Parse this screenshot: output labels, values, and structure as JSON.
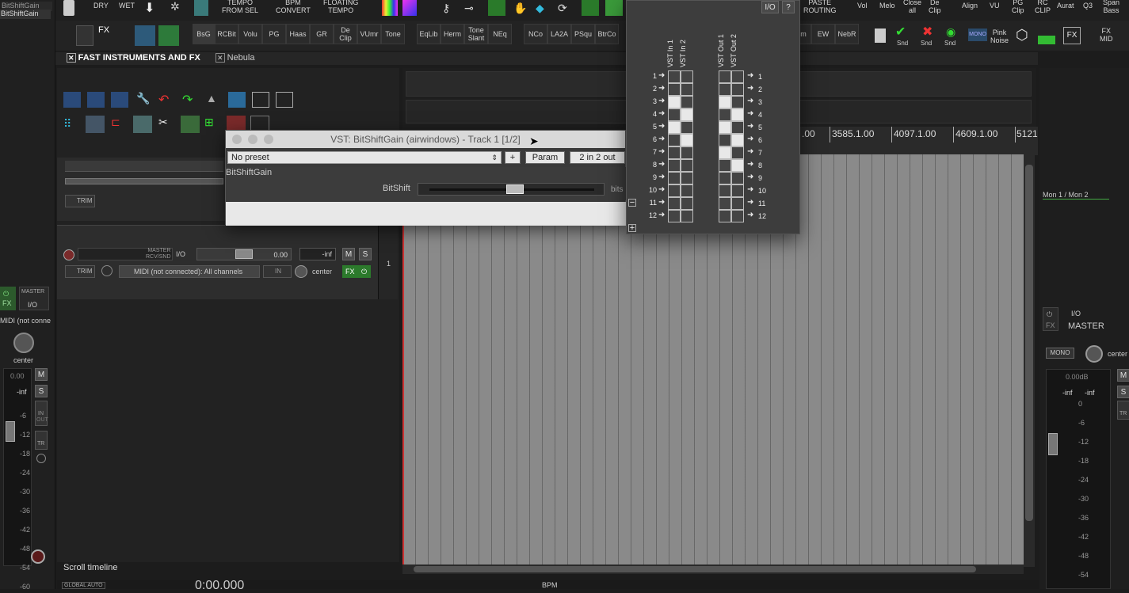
{
  "left_mixer": {
    "track_names": [
      "BitShiftGain",
      "BitShiftGain"
    ],
    "fx_label": "FX",
    "master_label": "MASTER",
    "io_label": "I/O",
    "midi_text": "MIDI (not conne",
    "pan_label": "center",
    "vol_value": "0.00",
    "peak_value": "-inf",
    "mute": "M",
    "solo": "S",
    "in_label": "IN",
    "out_label": "OUT",
    "trim_label": "TR",
    "scale": [
      "-6",
      "-12",
      "-18",
      "-24",
      "-30",
      "-36",
      "-42",
      "-48",
      "-54",
      "-60"
    ]
  },
  "toolbar_top": {
    "buttons": [
      "DRY",
      "WET",
      "TEMPO\nFROM SEL",
      "BPM\nCONVERT",
      "FLOATING\nTEMPO",
      "PASTE\nROUTING",
      "Vol",
      "Melo",
      "Close\nall",
      "De\nClip",
      "Align",
      "VU",
      "PG\nClip",
      "RC\nCLIP",
      "Aurat",
      "Q3",
      "Span\nBass"
    ]
  },
  "toolbar_2": {
    "fx_label": "FX",
    "buttons": [
      "BsG",
      "RCBit",
      "Volu",
      "PG",
      "Haas",
      "GR",
      "De\nClip",
      "VUmr",
      "Tone",
      "EqLib",
      "Herm",
      "Tone\nSlant",
      "NEq",
      "NCo",
      "LA2A",
      "PSqu",
      "BtrCo"
    ],
    "right_buttons": [
      "m",
      "EW",
      "NebR"
    ],
    "snd_labels": [
      "Snd",
      "Snd",
      "Snd"
    ],
    "mono_label": "MONO",
    "pink_noise": "Pink\nNoise",
    "fx_mid": "FX\nMID"
  },
  "tabs": [
    {
      "label": "FAST INSTRUMENTS AND FX",
      "active": true
    },
    {
      "label": "Nebula",
      "active": false
    }
  ],
  "track": {
    "number": "1",
    "master_send": "MASTER\nRCV/SND",
    "io": "I/O",
    "volume": "0.00",
    "peak": "-inf",
    "mute": "M",
    "solo": "S",
    "trim": "TRIM",
    "midi_input": "MIDI (not connected): All channels",
    "in_label": "IN",
    "pan": "center",
    "fx": "FX",
    "meter_ticks": [
      "-60",
      "-54",
      "-48",
      "-42",
      "-36",
      "-30",
      "-24",
      "-18",
      "-12",
      "-6"
    ]
  },
  "timeline": {
    "markers": [
      ".00",
      "3585.1.00",
      "4097.1.00",
      "4609.1.00",
      "5121"
    ]
  },
  "plugin_window": {
    "title": "VST: BitShiftGain (airwindows) - Track 1 [1/2]",
    "preset": "No preset",
    "add_label": "+",
    "param_label": "Param",
    "io_label": "2 in 2 out",
    "plugin_name": "BitShiftGain",
    "param_name": "BitShift",
    "param_unit": "bits",
    "param_value_fraction": 0.52
  },
  "pin_connector": {
    "io_btn": "I/O",
    "help_btn": "?",
    "in_headers": [
      "VST In 1",
      "VST In 2"
    ],
    "out_headers": [
      "VST Out 1",
      "VST Out 2"
    ],
    "rows": [
      "1",
      "2",
      "3",
      "4",
      "5",
      "6",
      "7",
      "8",
      "9",
      "10",
      "11",
      "12"
    ],
    "in_matrix": [
      [
        0,
        0
      ],
      [
        0,
        0
      ],
      [
        1,
        0
      ],
      [
        0,
        1
      ],
      [
        1,
        0
      ],
      [
        0,
        1
      ],
      [
        0,
        0
      ],
      [
        0,
        0
      ],
      [
        0,
        0
      ],
      [
        0,
        0
      ],
      [
        0,
        0
      ],
      [
        0,
        0
      ]
    ],
    "out_matrix": [
      [
        0,
        0
      ],
      [
        0,
        0
      ],
      [
        1,
        0
      ],
      [
        0,
        1
      ],
      [
        1,
        0
      ],
      [
        0,
        1
      ],
      [
        1,
        0
      ],
      [
        0,
        1
      ],
      [
        0,
        0
      ],
      [
        0,
        0
      ],
      [
        0,
        0
      ],
      [
        0,
        0
      ]
    ],
    "minus": "−",
    "plus": "+"
  },
  "right_panel": {
    "track_label": "Mon 1 / Mon 2",
    "io": "I/O",
    "fx": "FX",
    "master": "MASTER",
    "mono": "MONO",
    "pan": "center",
    "vol": "0.00dB",
    "peak_l": "-inf",
    "peak_r": "-inf",
    "mute": "M",
    "solo": "S",
    "trim": "TR",
    "scale": [
      "0",
      "-6",
      "-12",
      "-18",
      "-24",
      "-30",
      "-36",
      "-42",
      "-48",
      "-54"
    ]
  },
  "bottom": {
    "scroll_timeline": "Scroll timeline",
    "global_auto": "GLOBAL AUTO",
    "time": "0:00.000",
    "bpm": "BPM"
  }
}
